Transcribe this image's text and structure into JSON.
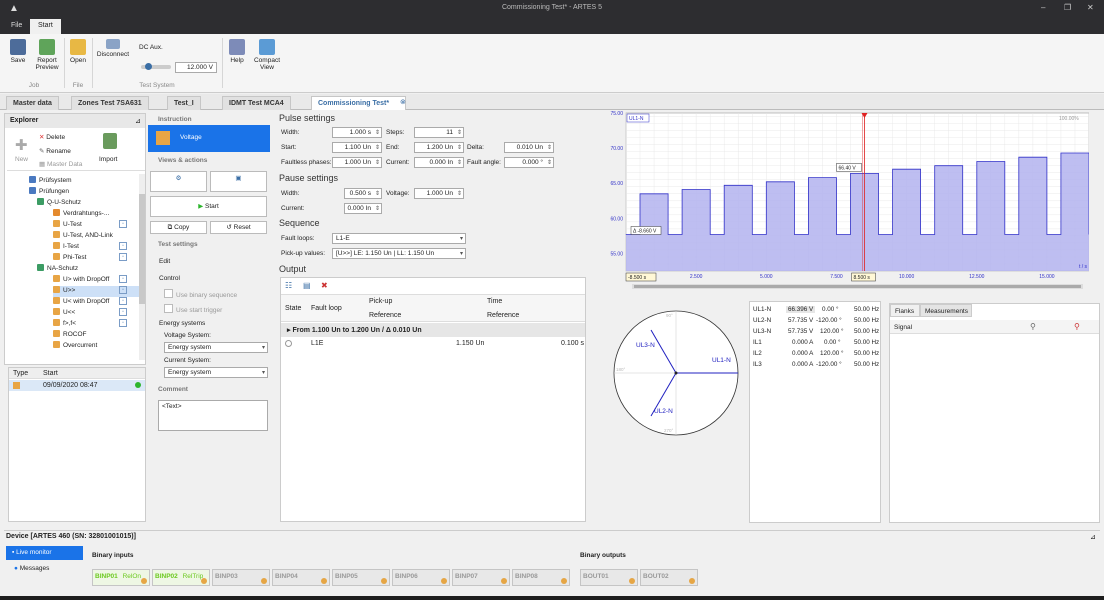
{
  "app": {
    "title": "Commissioning Test* - ARTES 5"
  },
  "menu": {
    "file": "File",
    "start": "Start"
  },
  "ribbon": {
    "save": "Save",
    "report_preview": "Report Preview",
    "open": "Open",
    "disconnect": "Disconnect",
    "dc_aux": "DC Aux.",
    "dc_value": "12.000 V",
    "help": "Help",
    "compact_view": "Compact View",
    "group_job": "Job",
    "group_file": "File",
    "group_test_system": "Test System"
  },
  "tabs": [
    "Master data",
    "Zones Test 7SA631",
    "Test_I",
    "IDMT Test MCA4",
    "Commissioning Test*"
  ],
  "explorer": {
    "title": "Explorer",
    "delete": "Delete",
    "rename": "Rename",
    "new": "New",
    "master_data": "Master Data",
    "import": "Import",
    "tree": [
      {
        "label": "Prüfsystem",
        "indent": 1
      },
      {
        "label": "Prüfungen",
        "indent": 1
      },
      {
        "label": "Q-U-Schutz",
        "indent": 2
      },
      {
        "label": "Verdrahtungs-...",
        "indent": 3
      },
      {
        "label": "U-Test",
        "indent": 3
      },
      {
        "label": "U-Test, AND-Link",
        "indent": 3
      },
      {
        "label": "I-Test",
        "indent": 3
      },
      {
        "label": "Phi-Test",
        "indent": 3
      },
      {
        "label": "NA-Schutz",
        "indent": 2
      },
      {
        "label": "U> with DropOff",
        "indent": 3
      },
      {
        "label": "U>>",
        "indent": 3,
        "selected": true
      },
      {
        "label": "U< with DropOff",
        "indent": 3
      },
      {
        "label": "U<<",
        "indent": 3
      },
      {
        "label": "f>,f<",
        "indent": 3
      },
      {
        "label": "ROCOF",
        "indent": 3
      },
      {
        "label": "Overcurrent",
        "indent": 3
      }
    ],
    "table": {
      "col_type": "Type",
      "col_start": "Start",
      "row_start": "09/09/2020 08:47"
    }
  },
  "nav": {
    "instruction": "Instruction",
    "voltage": "Voltage",
    "views_actions": "Views & actions",
    "start": "Start",
    "copy": "Copy",
    "reset": "Reset",
    "test_settings": "Test settings",
    "edit": "Edit",
    "control": "Control",
    "use_binary_sequence": "Use binary sequence",
    "use_start_trigger": "Use start trigger",
    "energy_systems": "Energy systems",
    "voltage_system": "Voltage System:",
    "voltage_system_value": "Energy system",
    "current_system": "Current System:",
    "current_system_value": "Energy system",
    "comment": "Comment",
    "comment_placeholder": "<Text>"
  },
  "pulse": {
    "title": "Pulse settings",
    "width_l": "Width:",
    "width": "1.000 s",
    "steps_l": "Steps:",
    "steps": "11",
    "start_l": "Start:",
    "start": "1.100 Un",
    "end_l": "End:",
    "end": "1.200 Un",
    "delta_l": "Delta:",
    "delta": "0.010 Un",
    "faultless_l": "Faultless phases:",
    "faultless": "1.000 Un",
    "current_l": "Current:",
    "current": "0.000 In",
    "angle_l": "Fault angle:",
    "angle": "0.000 °"
  },
  "pause": {
    "title": "Pause settings",
    "width_l": "Width:",
    "width": "0.500 s",
    "voltage_l": "Voltage:",
    "voltage": "1.000 Un",
    "current_l": "Current:",
    "current": "0.000 In"
  },
  "sequence": {
    "title": "Sequence",
    "fault_loops_l": "Fault loops:",
    "fault_loops": "L1-E",
    "pickup_l": "Pick-up values:",
    "pickup": "[U>>] LE: 1.150 Un | LL: 1.150 Un"
  },
  "output": {
    "title": "Output",
    "col_state": "State",
    "col_fault_loop": "Fault loop",
    "col_pickup": "Pick-up",
    "col_reference": "Reference",
    "col_time": "Time",
    "col_time_ref": "Reference",
    "group": "From 1.100 Un to 1.200 Un / Δ 0.010 Un",
    "row": {
      "loop": "L1E",
      "pickup": "1.150 Un",
      "time": "0.100 s"
    }
  },
  "chart_data": {
    "type": "line",
    "series_label": "UL1-N",
    "zoom": "100.00%",
    "xlabel": "t / s",
    "xlim": [
      0,
      16.5
    ],
    "ylim": [
      52.5,
      75
    ],
    "yticks": [
      "75.00",
      "70.00",
      "65.00",
      "60.00",
      "55.00"
    ],
    "xticks": [
      "2.500",
      "5.000",
      "7.500",
      "10.000",
      "12.500",
      "15.000"
    ],
    "pulse_levels": [
      63.5,
      64.1,
      64.7,
      65.2,
      65.8,
      66.4,
      67.0,
      67.5,
      68.1,
      68.7,
      69.3
    ],
    "pause_level": 57.7,
    "cursor_a": "-8.500 s",
    "cursor_b": "8.500 s",
    "marker_value": "66.40 V",
    "delta_value": "Δ -8.660 V",
    "colors": {
      "fill": "#b3b3ef",
      "line": "#3030c8",
      "cursor": "#e02020"
    }
  },
  "vector": {
    "labels": [
      "UL1-N",
      "UL2-N",
      "UL3-N"
    ],
    "angles": [
      "90°",
      "180°",
      "270°"
    ]
  },
  "measurements": [
    {
      "n": "UL1-N",
      "v": "66.396 V",
      "a": "0.00 °",
      "f": "50.00 Hz"
    },
    {
      "n": "UL2-N",
      "v": "57.735 V",
      "a": "-120.00 °",
      "f": "50.00 Hz"
    },
    {
      "n": "UL3-N",
      "v": "57.735 V",
      "a": "120.00 °",
      "f": "50.00 Hz"
    },
    {
      "n": "IL1",
      "v": "0.000 A",
      "a": "0.00 °",
      "f": "50.00 Hz"
    },
    {
      "n": "IL2",
      "v": "0.000 A",
      "a": "120.00 °",
      "f": "50.00 Hz"
    },
    {
      "n": "IL3",
      "v": "0.000 A",
      "a": "-120.00 °",
      "f": "50.00 Hz"
    }
  ],
  "right": {
    "tab_flanks": "Flanks",
    "tab_measurements": "Measurements",
    "col_signal": "Signal"
  },
  "device": {
    "title": "Device [ARTES 460 (SN: 32801001015)]",
    "live_monitor": "Live monitor",
    "messages": "Messages",
    "binary_inputs": "Binary inputs",
    "binary_outputs": "Binary outputs",
    "inputs": [
      {
        "name": "BINP01",
        "tag": "RelOn",
        "active": true
      },
      {
        "name": "BINP02",
        "tag": "RelTrip",
        "active": true
      },
      {
        "name": "BINP03"
      },
      {
        "name": "BINP04"
      },
      {
        "name": "BINP05"
      },
      {
        "name": "BINP06"
      },
      {
        "name": "BINP07"
      },
      {
        "name": "BINP08"
      }
    ],
    "outputs": [
      {
        "name": "BOUT01"
      },
      {
        "name": "BOUT02"
      }
    ]
  }
}
